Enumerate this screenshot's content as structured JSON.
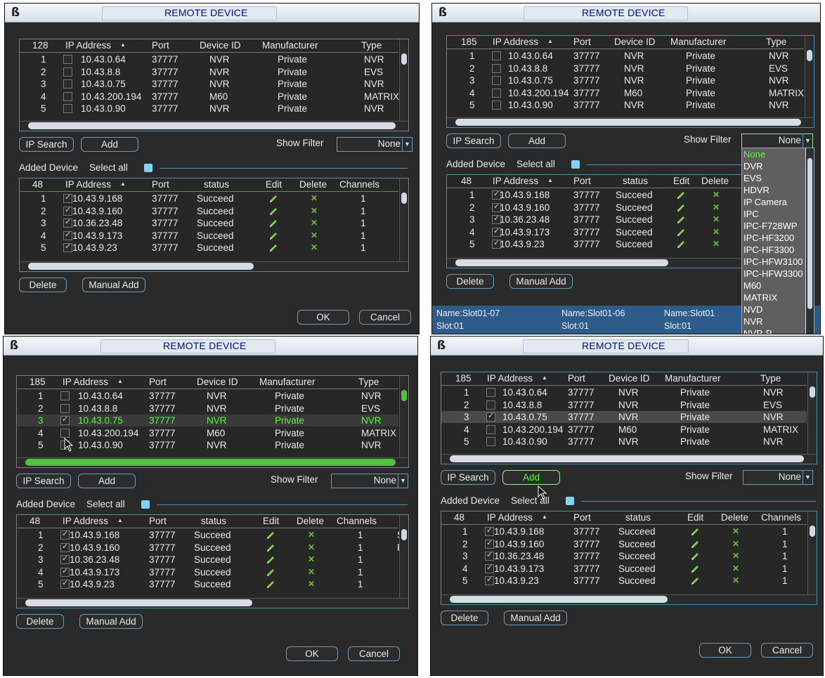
{
  "title": "REMOTE DEVICE",
  "search_table": {
    "count_headers": [
      "128",
      "185",
      "185",
      "185"
    ],
    "headers": [
      "IP Address",
      "Port",
      "Device ID",
      "Manufacturer",
      "Type"
    ],
    "rows": [
      {
        "no": "1",
        "ip": "10.43.0.64",
        "port": "37777",
        "id": "NVR",
        "mfr": "Private",
        "type": "NVR"
      },
      {
        "no": "2",
        "ip": "10.43.8.8",
        "port": "37777",
        "id": "NVR",
        "mfr": "Private",
        "type": "EVS"
      },
      {
        "no": "3",
        "ip": "10.43.0.75",
        "port": "37777",
        "id": "NVR",
        "mfr": "Private",
        "type": "NVR"
      },
      {
        "no": "4",
        "ip": "10.43.200.194",
        "port": "37777",
        "id": "M60",
        "mfr": "Private",
        "type": "MATRIX"
      },
      {
        "no": "5",
        "ip": "10.43.0.90",
        "port": "37777",
        "id": "NVR",
        "mfr": "Private",
        "type": "NVR"
      }
    ]
  },
  "buttons": {
    "ip_search": "IP Search",
    "add": "Add",
    "delete": "Delete",
    "manual_add": "Manual Add",
    "ok": "OK",
    "cancel": "Cancel"
  },
  "show_filter": {
    "label": "Show Filter",
    "value": "None"
  },
  "added_section": {
    "label": "Added Device",
    "select_all": "Select all"
  },
  "added_table": {
    "count_header": "48",
    "headers": [
      "IP Address",
      "Port",
      "status",
      "Edit",
      "Delete",
      "Channels"
    ],
    "rows": [
      {
        "no": "1",
        "ip": "10.43.9.168",
        "port": "37777",
        "status": "Succeed",
        "channels": "1",
        "extra": "S"
      },
      {
        "no": "2",
        "ip": "10.43.9.160",
        "port": "37777",
        "status": "Succeed",
        "channels": "1",
        "extra": "F"
      },
      {
        "no": "3",
        "ip": "10.36.23.48",
        "port": "37777",
        "status": "Succeed",
        "channels": "1",
        "extra": ""
      },
      {
        "no": "4",
        "ip": "10.43.9.173",
        "port": "37777",
        "status": "Succeed",
        "channels": "1",
        "extra": ""
      },
      {
        "no": "5",
        "ip": "10.43.9.23",
        "port": "37777",
        "status": "Succeed",
        "channels": "1",
        "extra": ""
      }
    ]
  },
  "filter_options": [
    "None",
    "DVR",
    "EVS",
    "HDVR",
    "IP Camera",
    "IPC",
    "IPC-F728WP",
    "IPC-HF3200",
    "IPC-HF3300",
    "IPC-HFW3100",
    "IPC-HFW3300",
    "M60",
    "MATRIX",
    "NVD",
    "NVR",
    "NVR-P"
  ],
  "status_bar": [
    {
      "name": "Name:Slot01-07",
      "slot": "Slot:01"
    },
    {
      "name": "Name:Slot01-06",
      "slot": "Slot:01"
    },
    {
      "name": "Name:Slot01",
      "slot": "Slot:01"
    }
  ],
  "colors": {
    "accent_border": "#4a8fb0",
    "selected_text": "#54ff30",
    "title_text": "#000a8e"
  }
}
